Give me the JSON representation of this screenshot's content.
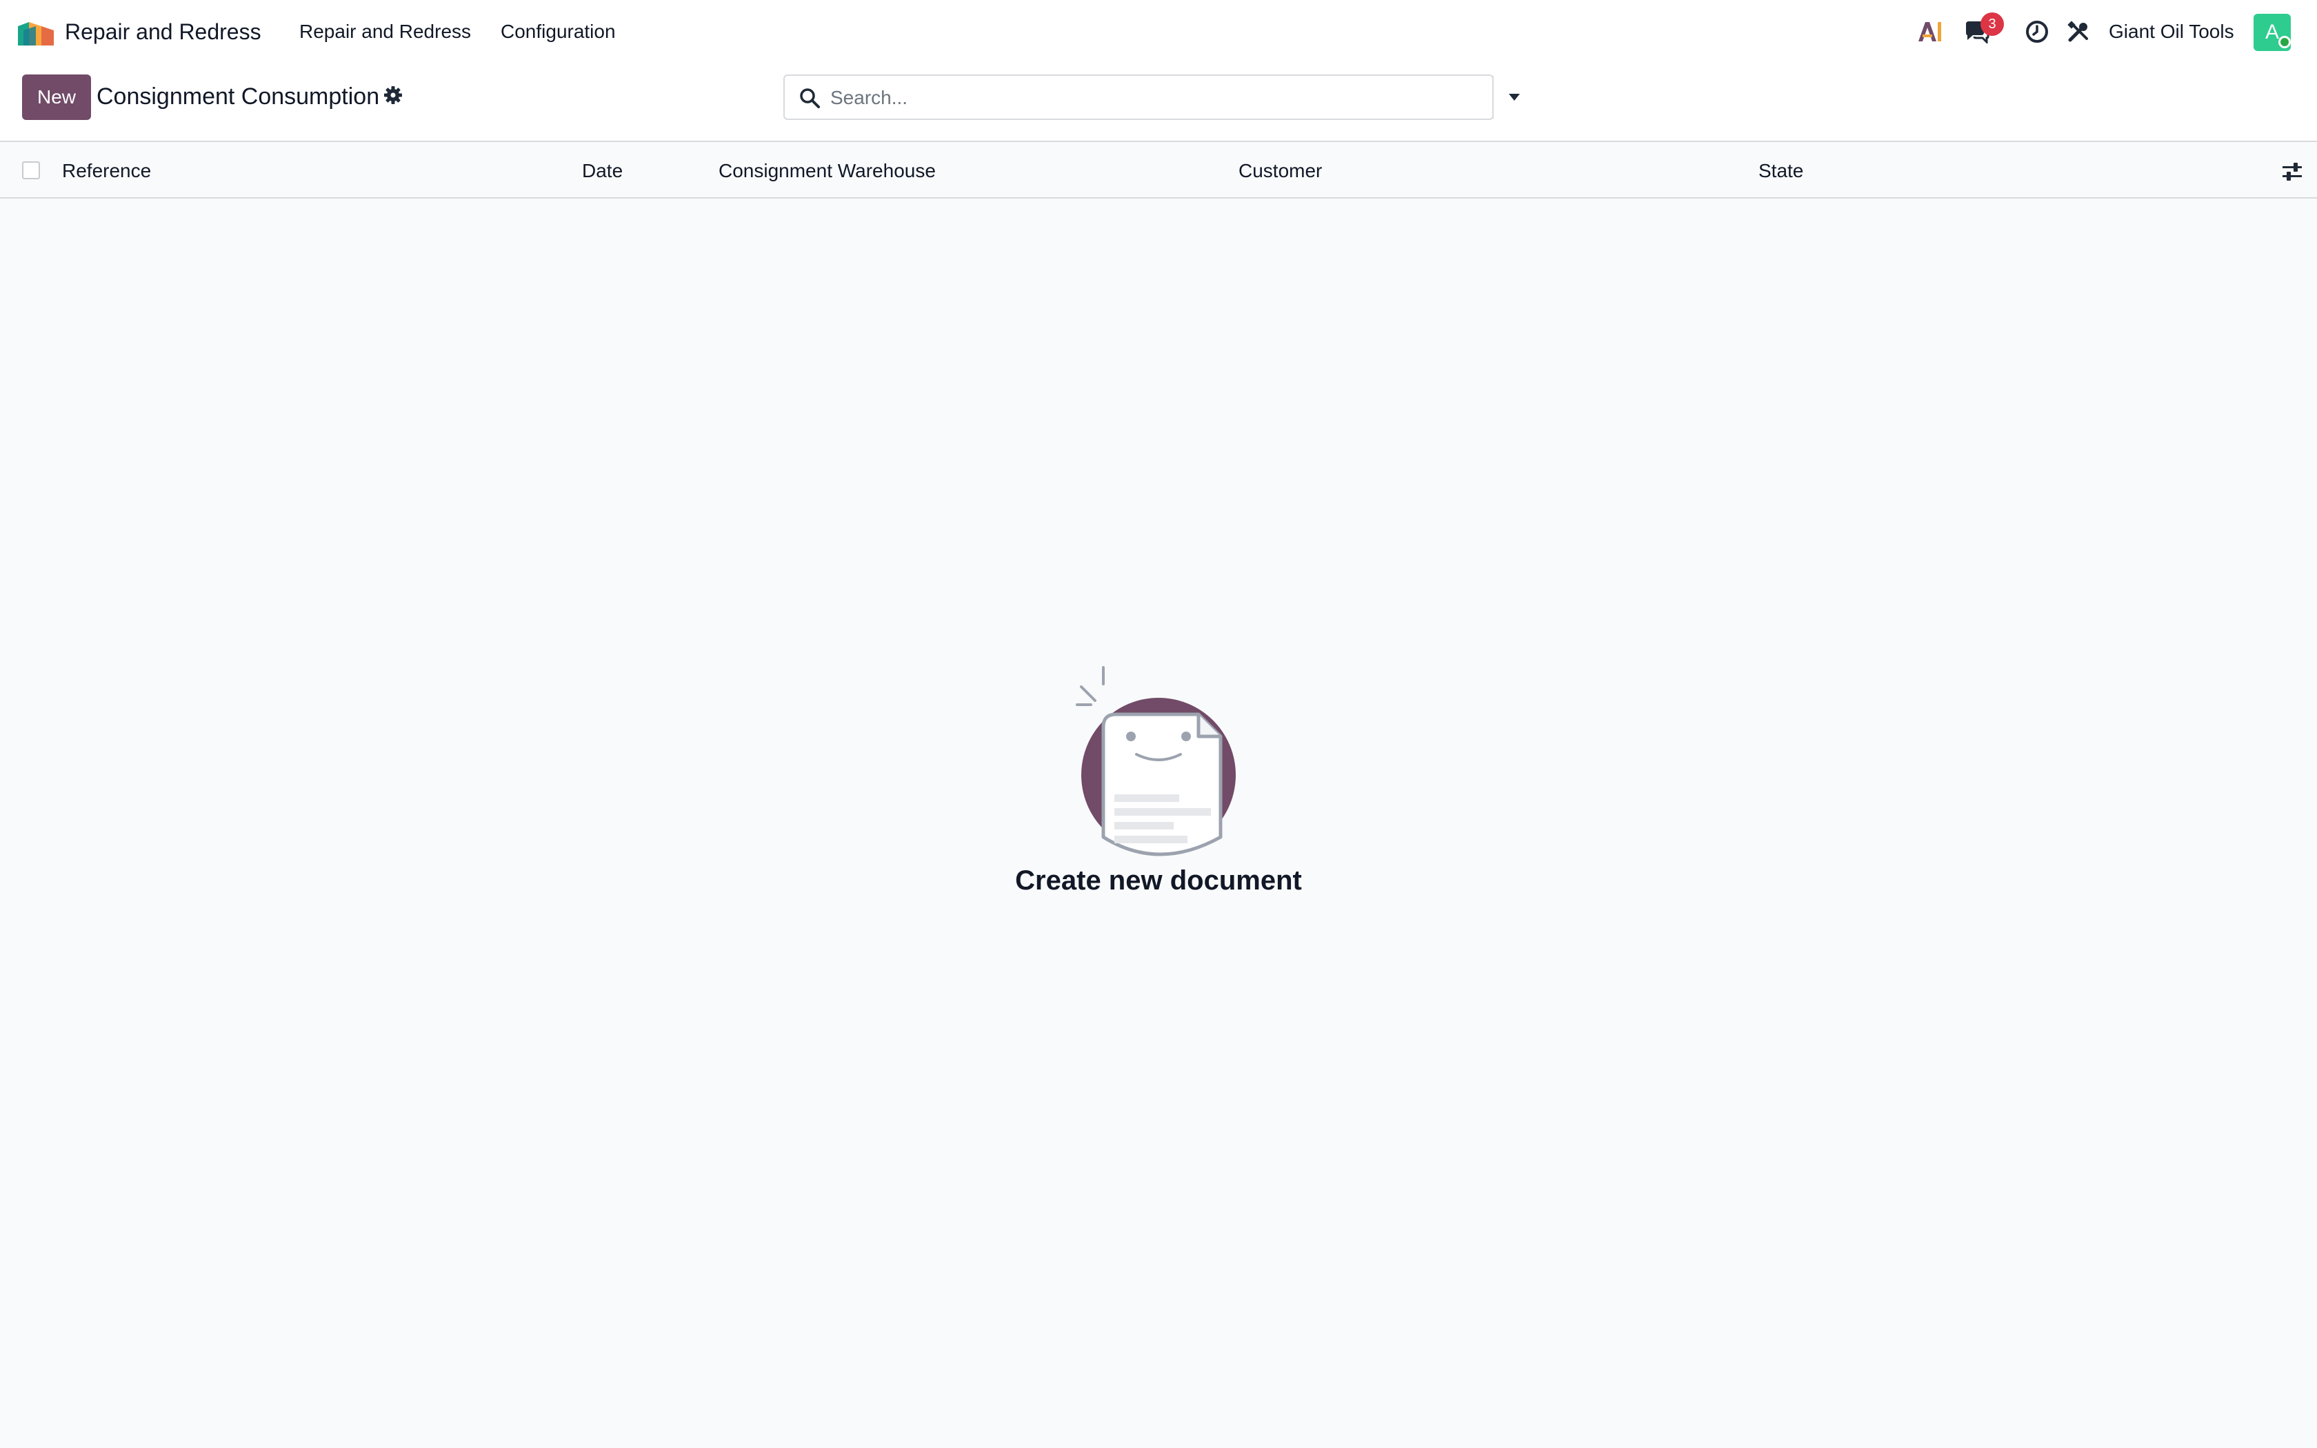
{
  "navbar": {
    "app_title": "Repair and Redress",
    "menus": [
      "Repair and Redress",
      "Configuration"
    ],
    "icons": [
      "ai-icon",
      "chat-icon",
      "clock-icon",
      "tools-icon"
    ],
    "messages_badge": "3",
    "company": "Giant Oil Tools",
    "avatar_initial": "A"
  },
  "control_panel": {
    "new_label": "New",
    "title": "Consignment Consumption",
    "search_placeholder": "Search..."
  },
  "list": {
    "columns": [
      "Reference",
      "Date",
      "Consignment Warehouse",
      "Customer",
      "State"
    ]
  },
  "empty_state": {
    "title": "Create new document"
  },
  "colors": {
    "brand": "#714b67",
    "badge": "#dc3545",
    "avatar": "#2ecc8f"
  }
}
